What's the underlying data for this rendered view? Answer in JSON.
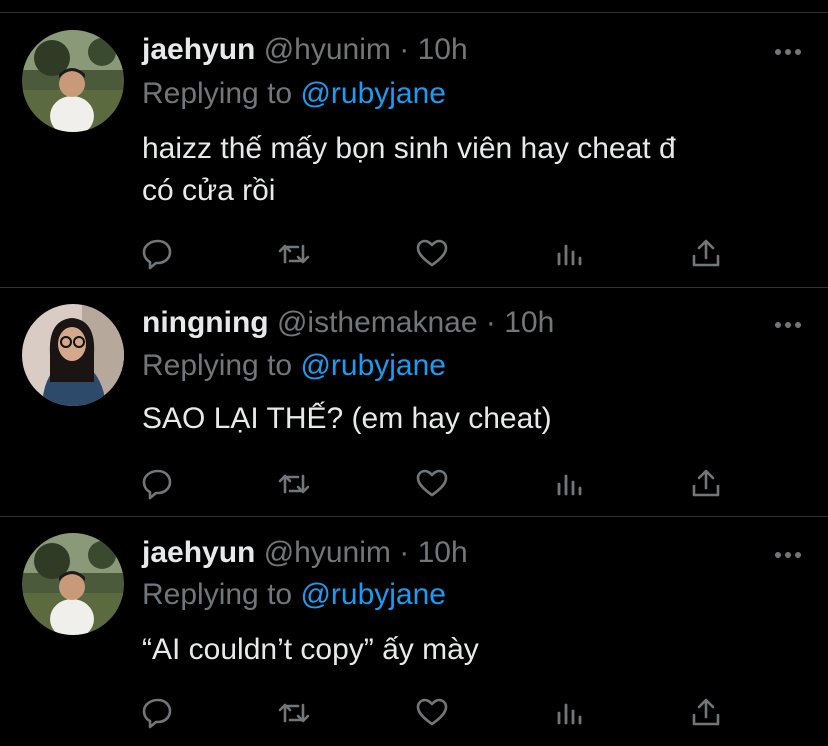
{
  "colors": {
    "background": "#000000",
    "text": "#e7e9ea",
    "muted": "#71767b",
    "link": "#1d9bf0",
    "divider": "#2f3336"
  },
  "icons": [
    "reply-icon",
    "retweet-icon",
    "like-icon",
    "analytics-icon",
    "share-icon",
    "more-icon"
  ],
  "tweets": [
    {
      "name": "jaehyun",
      "handle": "@hyunim",
      "dot": "·",
      "time": "10h",
      "reply_label": "Replying to",
      "reply_to": "@rubyjane",
      "lines": [
        "haizz thế mấy bọn sinh viên hay cheat đ",
        "có cửa rồi"
      ]
    },
    {
      "name": "ningning",
      "handle": "@isthemaknae",
      "dot": "·",
      "time": "10h",
      "reply_label": "Replying to",
      "reply_to": "@rubyjane",
      "lines": [
        "SAO LẠI THẾ? (em hay cheat)"
      ]
    },
    {
      "name": "jaehyun",
      "handle": "@hyunim",
      "dot": "·",
      "time": "10h",
      "reply_label": "Replying to",
      "reply_to": "@rubyjane",
      "lines": [
        "“AI couldn’t copy” ấy mày"
      ]
    }
  ]
}
